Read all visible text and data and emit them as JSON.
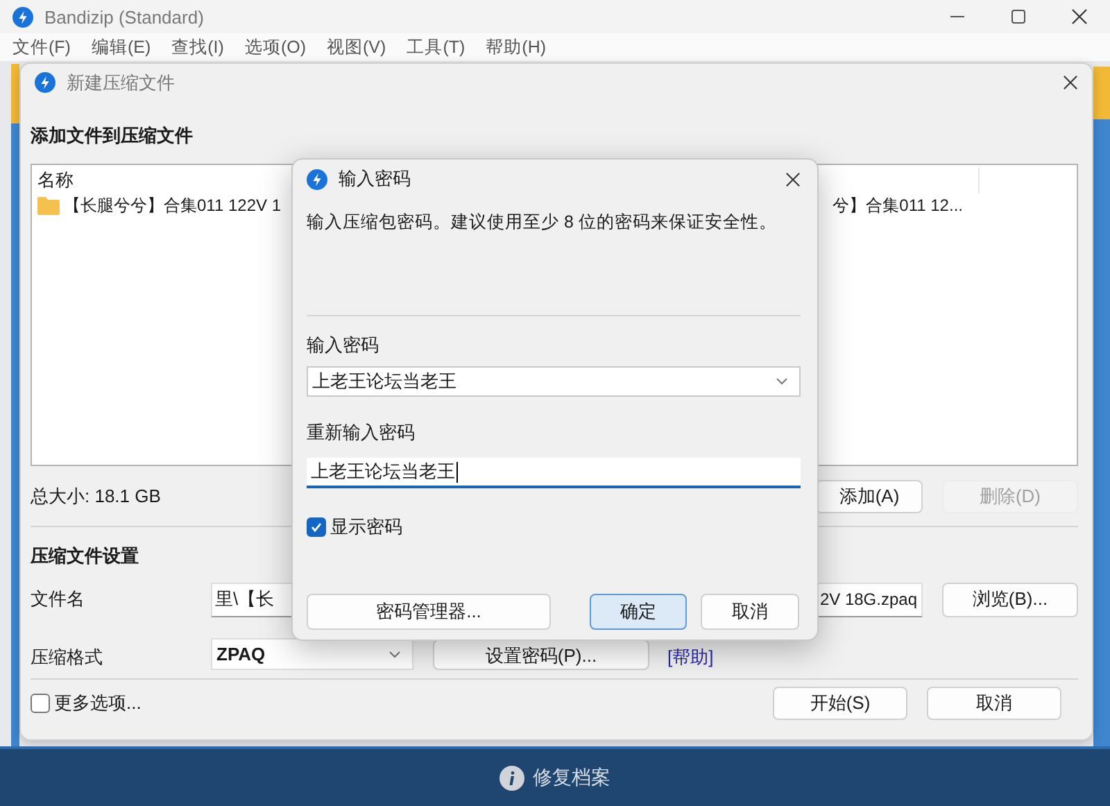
{
  "app_window": {
    "title": "Bandizip (Standard)",
    "menu": [
      "文件(F)",
      "编辑(E)",
      "查找(I)",
      "选项(O)",
      "视图(V)",
      "工具(T)",
      "帮助(H)"
    ]
  },
  "new_archive_dialog": {
    "title": "新建压缩文件",
    "files_heading": "添加文件到压缩文件",
    "file_list": {
      "columns": [
        "名称"
      ],
      "rows": [
        {
          "name_start": "【长腿兮兮】合集011 122V 1",
          "name_end": "兮】合集011 12..."
        }
      ]
    },
    "total_size": "总大小: 18.1 GB",
    "add_button": "添加(A)",
    "delete_button": {
      "label": "删除(D)",
      "disabled": true
    },
    "settings_heading": "压缩文件设置",
    "filename_label": "文件名",
    "filename_start": "里\\【长",
    "filename_end": "2V 18G.zpaq",
    "browse_button": "浏览(B)...",
    "format_label": "压缩格式",
    "format": "ZPAQ",
    "set_password_button": "设置密码(P)...",
    "help_link": "[帮助]",
    "more_options": {
      "label": "更多选项...",
      "checked": false
    },
    "start_button": "开始(S)",
    "cancel_button": "取消"
  },
  "password_dialog": {
    "title": "输入密码",
    "message": "输入压缩包密码。建议使用至少 8 位的密码来保证安全性。",
    "password_label": "输入密码",
    "password": "上老王论坛当老王",
    "confirm_label": "重新输入密码",
    "confirm_password": "上老王论坛当老王",
    "show_password": {
      "label": "显示密码",
      "checked": true
    },
    "manager_button": "密码管理器...",
    "ok_button": "确定",
    "cancel_button": "取消"
  },
  "status_bar": {
    "label": "修复档案"
  }
}
